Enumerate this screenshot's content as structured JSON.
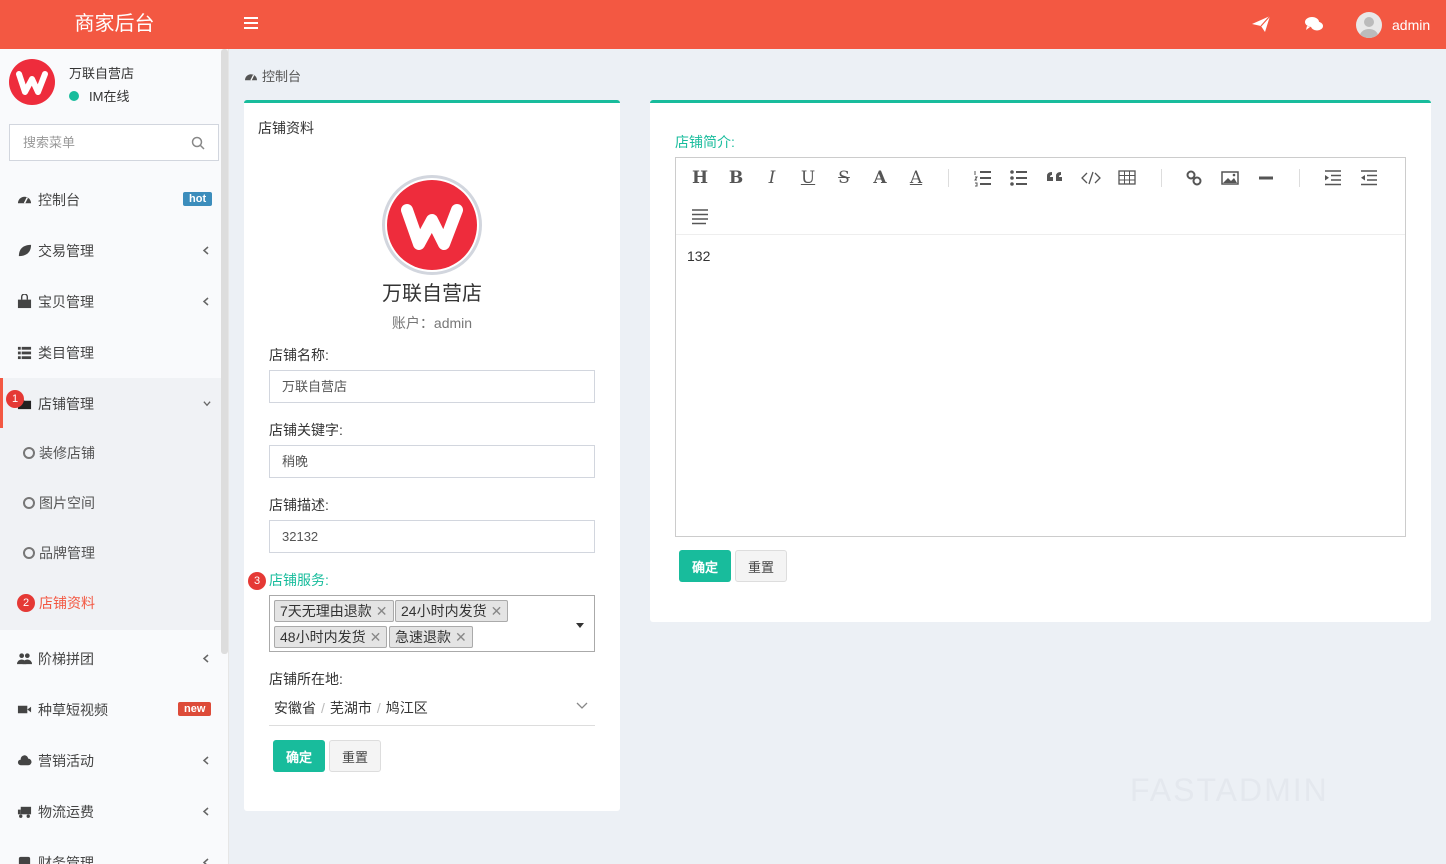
{
  "header": {
    "logo_text": "商家后台",
    "user_name": "admin"
  },
  "sidebar": {
    "shop_name": "万联自营店",
    "status": "IM在线",
    "search_placeholder": "搜索菜单",
    "items": [
      {
        "label": "控制台",
        "badge": "hot",
        "icon": "dashboard-icon"
      },
      {
        "label": "交易管理",
        "icon": "leaf-icon"
      },
      {
        "label": "宝贝管理",
        "icon": "shopping-bag-icon"
      },
      {
        "label": "类目管理",
        "icon": "list-icon"
      },
      {
        "label": "店铺管理",
        "icon": "folder-icon"
      },
      {
        "label": "阶梯拼团",
        "icon": "users-icon"
      },
      {
        "label": "种草短视频",
        "badge": "new",
        "icon": "video-icon"
      },
      {
        "label": "营销活动",
        "icon": "cloud-icon"
      },
      {
        "label": "物流运费",
        "icon": "truck-icon"
      },
      {
        "label": "财务管理",
        "icon": "money-icon"
      }
    ],
    "sub_items": [
      {
        "label": "装修店铺"
      },
      {
        "label": "图片空间"
      },
      {
        "label": "品牌管理"
      },
      {
        "label": "店铺资料"
      }
    ],
    "markers": [
      "1",
      "2",
      "3"
    ]
  },
  "breadcrumb": "控制台",
  "profile": {
    "panel_title": "店铺资料",
    "store_name": "万联自营店",
    "account": "账户：admin",
    "fields": {
      "name_label": "店铺名称:",
      "name_value": "万联自营店",
      "keywords_label": "店铺关键字:",
      "keywords_value": "稍晚",
      "desc_label": "店铺描述:",
      "desc_value": "32132",
      "service_label": "店铺服务:",
      "services": [
        "7天无理由退款",
        "24小时内发货",
        "48小时内发货",
        "急速退款"
      ],
      "location_label": "店铺所在地:",
      "province": "安徽省",
      "city": "芜湖市",
      "district": "鸠江区"
    },
    "ok_label": "确定",
    "reset_label": "重置"
  },
  "intro": {
    "label": "店铺简介:",
    "content": "132",
    "ok_label": "确定",
    "reset_label": "重置"
  },
  "watermark": "FASTADMIN",
  "colors": {
    "brand": "#f35842",
    "accent": "#18bc9c",
    "hot_badge": "#3c8dbc",
    "new_badge": "#dd4b39"
  }
}
